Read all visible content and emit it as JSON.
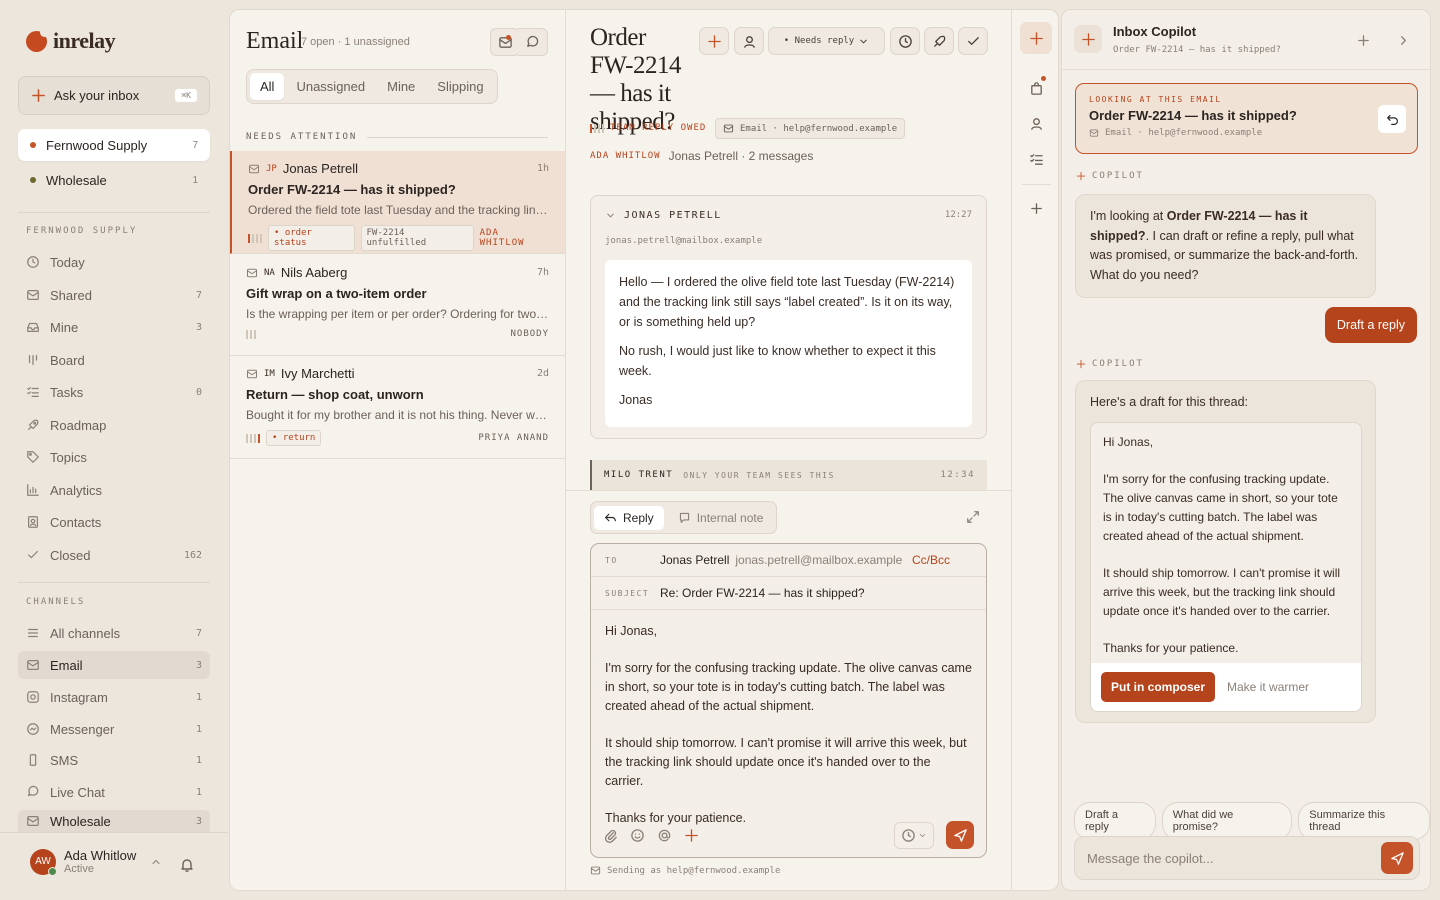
{
  "app": {
    "name": "inrelay"
  },
  "sidebar": {
    "ask": {
      "label": "Ask your inbox",
      "shortcut": "⌘K"
    },
    "accounts": [
      {
        "label": "Fernwood Supply",
        "count": "7",
        "color": "#c5532a"
      },
      {
        "label": "Wholesale",
        "count": "1",
        "color": "#6e6a2e"
      }
    ],
    "section_label": "FERNWOOD SUPPLY",
    "nav": [
      {
        "label": "Today",
        "count": "",
        "icon": "clock-icon"
      },
      {
        "label": "Shared",
        "count": "7",
        "icon": "inbox-icon"
      },
      {
        "label": "Mine",
        "count": "3",
        "icon": "tray-icon"
      },
      {
        "label": "Board",
        "count": "",
        "icon": "board-icon"
      },
      {
        "label": "Tasks",
        "count": "0",
        "icon": "tasks-icon"
      },
      {
        "label": "Roadmap",
        "count": "",
        "icon": "rocket-icon"
      },
      {
        "label": "Topics",
        "count": "",
        "icon": "tag-icon"
      },
      {
        "label": "Analytics",
        "count": "",
        "icon": "chart-icon"
      },
      {
        "label": "Contacts",
        "count": "",
        "icon": "contact-icon"
      },
      {
        "label": "Closed",
        "count": "162",
        "icon": "check-icon"
      }
    ],
    "channels_label": "CHANNELS",
    "channels": [
      {
        "label": "All channels",
        "count": "7"
      },
      {
        "label": "Email",
        "count": "3"
      },
      {
        "label": "Instagram",
        "count": "1"
      },
      {
        "label": "Messenger",
        "count": "1"
      },
      {
        "label": "SMS",
        "count": "1"
      },
      {
        "label": "Live Chat",
        "count": "1"
      },
      {
        "label": "Wholesale",
        "count": "3"
      }
    ],
    "user": {
      "initials": "AW",
      "name": "Ada Whitlow",
      "status": "Active"
    }
  },
  "list": {
    "title": "Email",
    "subtitle": "7 open · 1 unassigned",
    "tabs": [
      "All",
      "Unassigned",
      "Mine",
      "Slipping"
    ],
    "attention_label": "NEEDS ATTENTION",
    "conversations": [
      {
        "initials": "JP",
        "name": "Jonas Petrell",
        "time": "1h",
        "subject": "Order FW-2214 — has it shipped?",
        "preview": "Ordered the field tote last Tuesday and the tracking link still says \"label created\"",
        "tags": [
          "• order status",
          "FW-2214 unfulfilled"
        ],
        "assignee": "ADA WHITLOW"
      },
      {
        "initials": "NA",
        "name": "Nils Aaberg",
        "time": "7h",
        "subject": "Gift wrap on a two-item order",
        "preview": "Is the wrapping per item or per order? Ordering for two people",
        "tags": [],
        "assignee": "NOBODY"
      },
      {
        "initials": "IM",
        "name": "Ivy Marchetti",
        "time": "2d",
        "subject": "Return — shop coat, unworn",
        "preview": "Bought it for my brother and it is not his thing. Never worn, tags on",
        "tags": [
          "• return"
        ],
        "assignee": "PRIYA ANAND"
      }
    ]
  },
  "thread": {
    "title": "Order FW-2214 — has it shipped?",
    "status": "• Needs reply",
    "owed": "TEAM REPLY OWED",
    "channel_chip": "Email · help@fernwood.example",
    "assignee": "ADA WHITLOW",
    "meta": "Jonas Petrell · 2 messages",
    "message": {
      "sender": "JONAS PETRELL",
      "time": "12:27",
      "from": "jonas.petrell@mailbox.example",
      "paragraphs": [
        "Hello — I ordered the olive field tote last Tuesday (FW-2214) and the tracking link still says “label created”. Is it on its way, or is something held up?",
        "No rush, I would just like to know whether to expect it this week.",
        "Jonas"
      ]
    },
    "note": {
      "author": "MILO TRENT",
      "label": "ONLY YOUR TEAM SEES THIS",
      "time": "12:34"
    },
    "composer": {
      "tab_reply": "Reply",
      "tab_note": "Internal note",
      "to_label": "TO",
      "to_name": "Jonas Petrell",
      "to_email": "jonas.petrell@mailbox.example",
      "ccbcc": "Cc/Bcc",
      "subject_label": "SUBJECT",
      "subject": "Re: Order FW-2214 — has it shipped?",
      "paragraphs": [
        "Hi Jonas,",
        "I'm sorry for the confusing tracking update. The olive canvas came in short, so your tote is in today's cutting batch. The label was created ahead of the actual shipment.",
        "It should ship tomorrow. I can't promise it will arrive this week, but the tracking link should update once it's handed over to the carrier.",
        "Thanks for your patience."
      ],
      "sending_as": "Sending as help@fernwood.example"
    }
  },
  "copilot": {
    "title": "Inbox Copilot",
    "subtitle": "Order FW-2214 — has it shipped?",
    "looking_label": "LOOKING AT THIS EMAIL",
    "looking_title": "Order FW-2214 — has it shipped?",
    "looking_meta": "Email · help@fernwood.example",
    "label": "COPILOT",
    "msg1_pre": "I'm looking at ",
    "msg1_bold": "Order FW-2214 — has it shipped?",
    "msg1_post": ". I can draft or refine a reply, pull what was promised, or summarize the back-and-forth. What do you need?",
    "user_msg": "Draft a reply",
    "msg2": "Here's a draft for this thread:",
    "draft": [
      "Hi Jonas,",
      "I'm sorry for the confusing tracking update. The olive canvas came in short, so your tote is in today's cutting batch. The label was created ahead of the actual shipment.",
      "It should ship tomorrow. I can't promise it will arrive this week, but the tracking link should update once it's handed over to the carrier.",
      "Thanks for your patience."
    ],
    "put_in_composer": "Put in composer",
    "make_warmer": "Make it warmer",
    "chips": [
      "Draft a reply",
      "What did we promise?",
      "Summarize this thread"
    ],
    "input_placeholder": "Message the copilot..."
  }
}
